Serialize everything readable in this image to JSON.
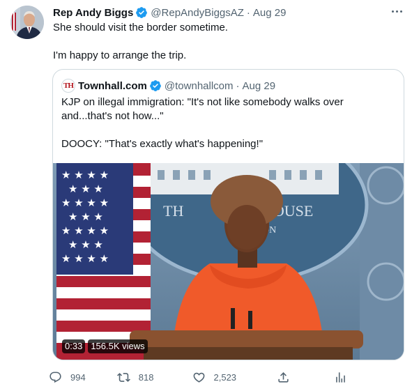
{
  "tweet": {
    "author_name": "Rep Andy Biggs",
    "author_handle": "@RepAndyBiggsAZ",
    "separator": "·",
    "date": "Aug 29",
    "text_line1": "She should visit the border sometime.",
    "text_line2": "I'm happy to arrange the trip."
  },
  "quoted": {
    "author_name": "Townhall.com",
    "avatar_text": "TH",
    "author_handle": "@townhallcom",
    "separator": "·",
    "date": "Aug 29",
    "text_line1": "KJP on illegal immigration: \"It's not like somebody walks over",
    "text_line2": "and...that's not how...\"",
    "text_line3": "DOOCY: \"That's exactly what's happening!\"",
    "video": {
      "duration": "0:33",
      "views": "156.5K views",
      "seal_text_left": "TH",
      "seal_text_right": "HOUSE",
      "seal_text_bottom": "ON"
    }
  },
  "actions": {
    "replies": "994",
    "retweets": "818",
    "likes": "2,523"
  },
  "icons": [
    "verified-badge-icon",
    "more-icon",
    "reply-icon",
    "retweet-icon",
    "like-icon",
    "share-icon",
    "analytics-icon"
  ],
  "colors": {
    "verified": "#1d9bf0",
    "text": "#0f1419",
    "muted": "#536471",
    "border": "#cfd9de"
  }
}
